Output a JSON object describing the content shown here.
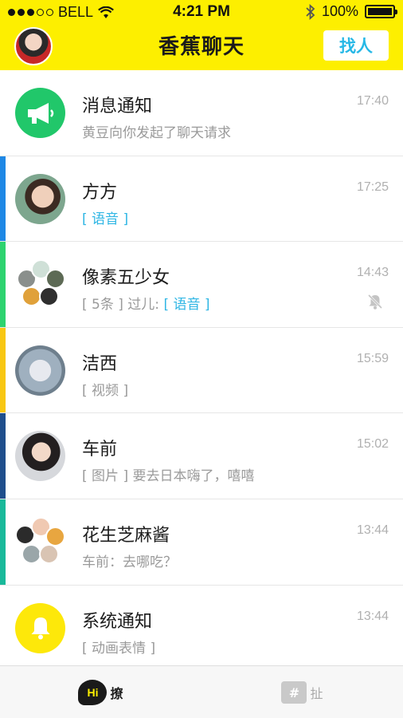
{
  "status_bar": {
    "carrier": "BELL",
    "time": "4:21 PM",
    "battery": "100%"
  },
  "header": {
    "title": "香蕉聊天",
    "find_button": "找人"
  },
  "chats": [
    {
      "name": "消息通知",
      "preview": "黄豆向你发起了聊天请求",
      "time": "17:40",
      "stripe": ""
    },
    {
      "name": "方方",
      "preview_prefix": "",
      "preview_highlight": "[ 语音 ]",
      "time": "17:25",
      "stripe": "#1e88e5"
    },
    {
      "name": "像素五少女",
      "preview_prefix": "[ 5条 ] 过儿: ",
      "preview_highlight": "[ 语音 ]",
      "time": "14:43",
      "stripe": "#2dd36f",
      "muted": true
    },
    {
      "name": "洁西",
      "preview": "[ 视频 ]",
      "time": "15:59",
      "stripe": "#f8c712"
    },
    {
      "name": "车前",
      "preview": "[ 图片 ] 要去日本嗨了，嘻嘻",
      "time": "15:02",
      "stripe": "#1f4e8c"
    },
    {
      "name": "花生芝麻酱",
      "preview": "车前：去哪吃？",
      "time": "13:44",
      "stripe": "#19b99a"
    },
    {
      "name": "系统通知",
      "preview": "[ 动画表情 ]",
      "time": "13:44",
      "stripe": ""
    }
  ],
  "tabs": [
    {
      "badge": "Hi",
      "label": "撩",
      "active": true
    },
    {
      "badge": "#",
      "label": "扯",
      "active": false
    }
  ]
}
